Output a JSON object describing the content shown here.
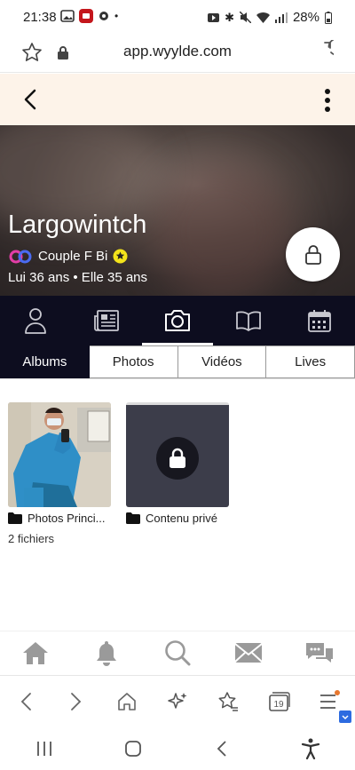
{
  "status_bar": {
    "time": "21:38",
    "battery": "28%"
  },
  "browser": {
    "url": "app.wyylde.com"
  },
  "profile": {
    "name": "Largowintch",
    "type": "Couple F Bi",
    "ages": "Lui 36 ans • Elle 35 ans"
  },
  "icon_tabs": [
    {
      "icon": "person-icon"
    },
    {
      "icon": "newspaper-icon"
    },
    {
      "icon": "camera-icon",
      "active": true
    },
    {
      "icon": "book-icon"
    },
    {
      "icon": "calendar-icon"
    }
  ],
  "media_tabs": [
    {
      "label": "Albums",
      "active": true
    },
    {
      "label": "Photos"
    },
    {
      "label": "Vidéos"
    },
    {
      "label": "Lives"
    }
  ],
  "albums": [
    {
      "label": "Photos Princi...",
      "count": "2 fichiers",
      "icon": "folder-icon"
    },
    {
      "label": "Contenu privé",
      "icon": "folder-icon",
      "locked": true
    }
  ],
  "colors": {
    "dark_navy": "#0d0d1f",
    "header_bg": "#fdf3e9",
    "nav_icon": "#9a9a9a",
    "badge_yellow": "#f3e31b"
  }
}
